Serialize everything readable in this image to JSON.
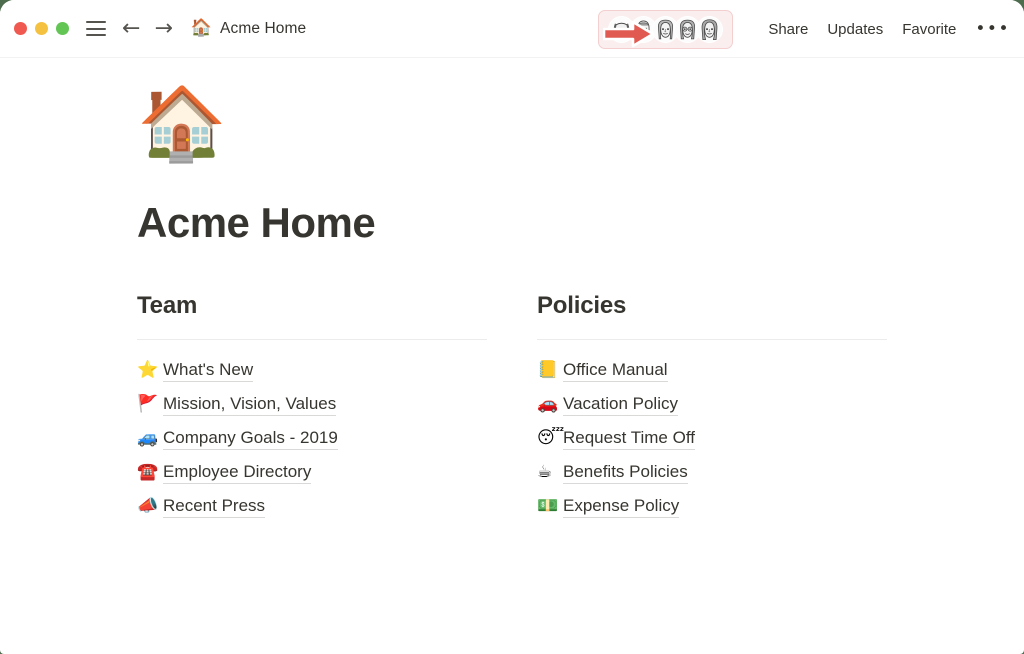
{
  "window": {
    "desktop_background": "#4d6b4d",
    "surface": "#ffffff"
  },
  "titlebar": {
    "traffic_lights": [
      {
        "name": "close",
        "color": "#f0594f"
      },
      {
        "name": "minimize",
        "color": "#f5c141"
      },
      {
        "name": "zoom",
        "color": "#62c554"
      }
    ],
    "menu_icon": "hamburger-icon",
    "back_icon": "←",
    "forward_icon": "→",
    "breadcrumb": {
      "emoji": "🏠",
      "label": "Acme Home"
    },
    "annotation": {
      "type": "arrow",
      "direction": "right",
      "color": "#e05a52",
      "points_to": "avatar-group"
    },
    "avatar_group": {
      "highlighted": true,
      "highlight_fill": "#fbeeee",
      "highlight_border": "#f3cfcf",
      "count": 5,
      "avatars": [
        {
          "name": "avatar-dog",
          "kind": "animal"
        },
        {
          "name": "avatar-person-1",
          "kind": "person"
        },
        {
          "name": "avatar-person-2",
          "kind": "person"
        },
        {
          "name": "avatar-person-3",
          "kind": "person"
        },
        {
          "name": "avatar-person-4",
          "kind": "person"
        }
      ]
    },
    "actions": [
      {
        "name": "share",
        "label": "Share"
      },
      {
        "name": "updates",
        "label": "Updates"
      },
      {
        "name": "favorite",
        "label": "Favorite"
      }
    ],
    "more_label": "•••"
  },
  "page": {
    "emoji": "🏠",
    "title": "Acme Home",
    "columns": [
      {
        "name": "team",
        "heading": "Team",
        "links": [
          {
            "emoji": "⭐",
            "label": "What's New"
          },
          {
            "emoji": "🚩",
            "label": "Mission, Vision, Values"
          },
          {
            "emoji": "🚙",
            "label": "Company Goals - 2019"
          },
          {
            "emoji": "☎️",
            "label": "Employee Directory"
          },
          {
            "emoji": "📣",
            "label": "Recent Press"
          }
        ]
      },
      {
        "name": "policies",
        "heading": "Policies",
        "links": [
          {
            "emoji": "📒",
            "label": "Office Manual"
          },
          {
            "emoji": "🚗",
            "label": "Vacation Policy"
          },
          {
            "emoji": "😴",
            "label": "Request Time Off"
          },
          {
            "emoji": "☕",
            "label": "Benefits Policies"
          },
          {
            "emoji": "💵",
            "label": "Expense Policy"
          }
        ]
      }
    ]
  }
}
